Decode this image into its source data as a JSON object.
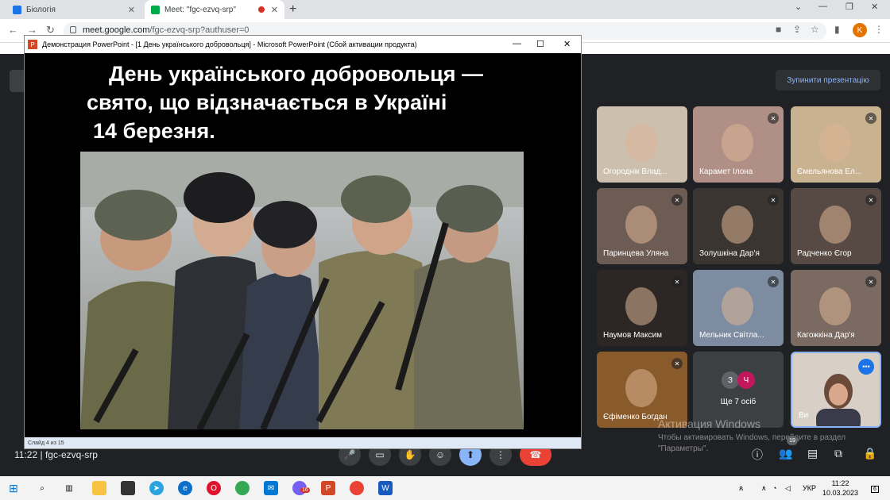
{
  "browser": {
    "tabs": [
      {
        "label": "Біологія",
        "color": "#1a73e8"
      },
      {
        "label": "Meet: \"fgc-ezvq-srp\"",
        "color": "#00ac47"
      }
    ],
    "url_host": "meet.google.com",
    "url_path": "/fgc-ezvq-srp?authuser=0",
    "profile_initial": "K"
  },
  "powerpoint": {
    "window_title": "Демонстрация PowerPoint - [1 День українського добровольця] - Microsoft PowerPoint (Сбой активации продукта)",
    "slide_title_lines": [
      "День українського добровольця —",
      "свято, що відзначається в Україні",
      "14 березня."
    ],
    "status": "Слайд 4 из 15"
  },
  "meet": {
    "stop_presenting": "Зупинити презентацію",
    "participants": [
      {
        "name": "Огороднік Влад...",
        "bg": "#cdbfae"
      },
      {
        "name": "Карамет Ілона",
        "bg": "#b08f86"
      },
      {
        "name": "Ємельянова Ел...",
        "bg": "#c9b28f"
      },
      {
        "name": "Паринцева Уляна",
        "bg": "#6d5c53"
      },
      {
        "name": "Золушкіна Дар'я",
        "bg": "#3a3530"
      },
      {
        "name": "Радченко Єгор",
        "bg": "#574a44"
      },
      {
        "name": "Наумов Максим",
        "bg": "#2c2624"
      },
      {
        "name": "Мельник Світла...",
        "bg": "#7d8ca0"
      },
      {
        "name": "Кагожкіна Дар'я",
        "bg": "#7a6a61"
      },
      {
        "name": "Єфіменко Богдан",
        "bg": "#8a5b2a"
      }
    ],
    "more_initials": [
      "З",
      "Ч"
    ],
    "more_label": "Ще 7 осіб",
    "self_label": "Ви",
    "meeting_time": "11:22",
    "meeting_code": "fgc-ezvq-srp",
    "people_count": "19",
    "activation_title": "Активация Windows",
    "activation_text": "Чтобы активировать Windows, перейдите в раздел \"Параметры\"."
  },
  "taskbar": {
    "lang": "УКР",
    "time": "11:22",
    "date": "10.03.2023",
    "notif_count": "6",
    "viber_badge": "16"
  }
}
